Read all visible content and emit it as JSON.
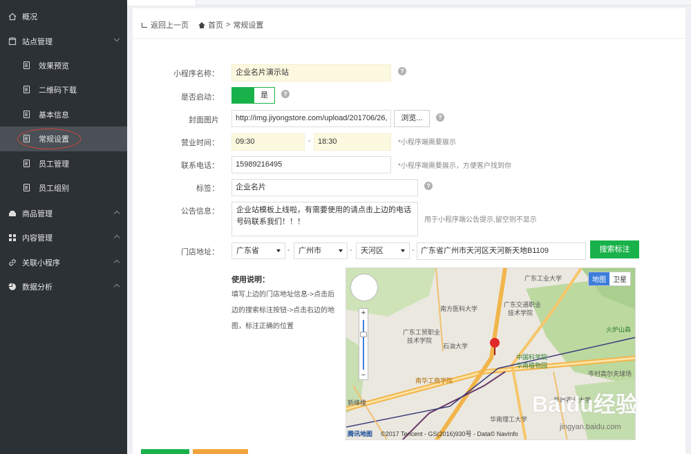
{
  "sidebar": {
    "items": [
      {
        "label": "概况",
        "icon": "home-icon"
      },
      {
        "label": "站点管理",
        "icon": "store-icon"
      },
      {
        "label": "效果预览",
        "icon": "doc-icon"
      },
      {
        "label": "二维码下载",
        "icon": "doc-icon"
      },
      {
        "label": "基本信息",
        "icon": "doc-icon"
      },
      {
        "label": "常规设置",
        "icon": "doc-icon"
      },
      {
        "label": "员工管理",
        "icon": "doc-icon"
      },
      {
        "label": "员工组别",
        "icon": "doc-icon"
      },
      {
        "label": "商品管理",
        "icon": "box-icon"
      },
      {
        "label": "内容管理",
        "icon": "grid-icon"
      },
      {
        "label": "关联小程序",
        "icon": "link-icon"
      },
      {
        "label": "数据分析",
        "icon": "pie-icon"
      }
    ]
  },
  "breadcrumb": {
    "back": "返回上一页",
    "home": "首页",
    "separator": ">",
    "current": "常规设置"
  },
  "form": {
    "name_label": "小程序名称：",
    "name_value": "企业名片演示站",
    "enabled_label": "是否启动：",
    "enabled_value": "是",
    "cover_label": "封面图片",
    "cover_value": "http://img.jiyongstore.com/upload/201706/26,",
    "browse_label": "浏览...",
    "hours_label": "营业时间：",
    "hours_start": "09:30",
    "hours_dash": "-",
    "hours_end": "18:30",
    "hours_hint": "*小程序端需要展示",
    "phone_label": "联系电话：",
    "phone_value": "15989216495",
    "phone_hint": "*小程序端需要展示，方便客户找到你",
    "tag_label": "标签：",
    "tag_value": "企业名片",
    "notice_label": "公告信息：",
    "notice_value": "企业站模板上线啦，有需要使用的请点击上边的电话号码联系我们！！！",
    "notice_hint": "用于小程序端公告提示,留空则不显示",
    "address_label": "门店地址：",
    "province": "广东省",
    "city": "广州市",
    "district": "天河区",
    "street": "广东省广州市天河区天河新天地B1109",
    "search_btn": "搜索标注",
    "usage_title": "使用说明：",
    "usage_lines": [
      "填写上边的门店地址信息->点击后",
      "边的搜索标注按钮->点击右边的地",
      "图，标注正确的位置"
    ],
    "help_glyph": "?"
  },
  "map": {
    "type_map": "地图",
    "type_satellite": "卫星",
    "zoom_plus": "+",
    "zoom_minus": "−",
    "logo": "腾讯地图",
    "copyright": "©2017 Tencent - GS(2016)930号 - Data© NavInfo",
    "labels": {
      "l1": "广东工业大学",
      "l2": "广东交通职业",
      "l3": "技术学院",
      "l4": "火炉山森",
      "l5": "中国科学院",
      "l6": "华南植物园",
      "l7": "广东工贸职业",
      "l8": "技术学院",
      "l9": "石油大学",
      "l10": "南方医科大学",
      "l11": "南华工商学院",
      "l12": "华南农业大学",
      "l13": "华南理工大学",
      "l14": "岑村高尔夫球场",
      "l15": "新峰楼"
    }
  },
  "watermark": {
    "big": "Baidu经验",
    "small": "jingyan.baidu.com"
  },
  "colors": {
    "sidebar_bg": "#2c3136",
    "accent_green": "#19b24a",
    "field_yellow": "#fdf8e0",
    "highlight_circle": "#d0463b"
  }
}
